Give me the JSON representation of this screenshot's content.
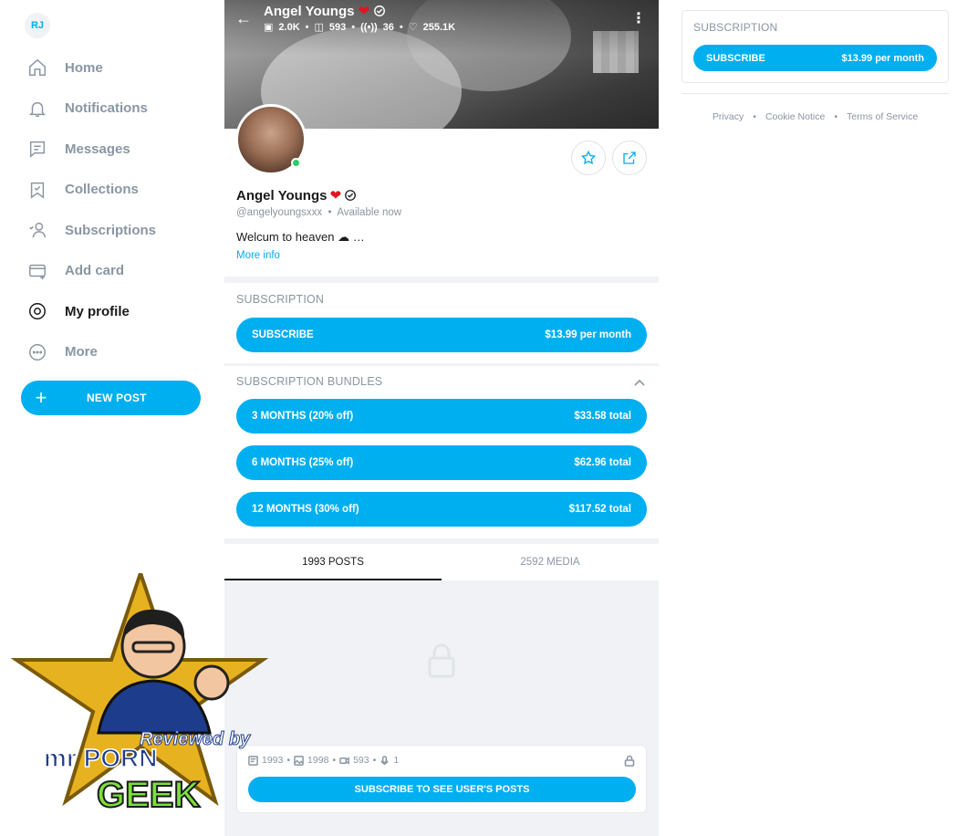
{
  "sidebar": {
    "avatar_initials": "RJ",
    "items": [
      {
        "label": "Home",
        "icon": "home-icon"
      },
      {
        "label": "Notifications",
        "icon": "bell-icon"
      },
      {
        "label": "Messages",
        "icon": "message-icon"
      },
      {
        "label": "Collections",
        "icon": "bookmark-icon"
      },
      {
        "label": "Subscriptions",
        "icon": "subscriptions-icon"
      },
      {
        "label": "Add card",
        "icon": "card-icon"
      },
      {
        "label": "My profile",
        "icon": "profile-icon"
      },
      {
        "label": "More",
        "icon": "more-icon"
      }
    ],
    "active_item": "My profile",
    "new_post_label": "NEW POST"
  },
  "cover": {
    "title": "Angel Youngs",
    "stats": {
      "photos": "2.0K",
      "videos": "593",
      "streams": "36",
      "likes": "255.1K"
    }
  },
  "profile": {
    "name": "Angel Youngs",
    "handle": "@angelyoungsxxx",
    "status": "Available now",
    "bio": "Welcum to heaven",
    "more_info": "More info"
  },
  "subscription": {
    "title": "SUBSCRIPTION",
    "button_label": "SUBSCRIBE",
    "price": "$13.99 per month"
  },
  "bundles": {
    "title": "SUBSCRIPTION BUNDLES",
    "items": [
      {
        "label": "3 MONTHS (20% off)",
        "price": "$33.58 total"
      },
      {
        "label": "6 MONTHS (25% off)",
        "price": "$62.96 total"
      },
      {
        "label": "12 MONTHS (30% off)",
        "price": "$117.52 total"
      }
    ]
  },
  "tabs": [
    {
      "label": "1993 POSTS",
      "active": true
    },
    {
      "label": "2592 MEDIA",
      "active": false
    }
  ],
  "locked": {
    "posts": "1993",
    "photos": "1998",
    "videos": "593",
    "audio": "1",
    "button_label": "SUBSCRIBE TO SEE USER'S POSTS"
  },
  "right": {
    "title": "SUBSCRIPTION",
    "button_label": "SUBSCRIBE",
    "price": "$13.99 per month",
    "footer_links": [
      "Privacy",
      "Cookie Notice",
      "Terms of Service"
    ]
  },
  "badge": {
    "line1": "Reviewed by",
    "line2": "mr PORN",
    "line3": "GEEK"
  },
  "colors": {
    "accent": "#00aff0",
    "muted": "#8a96a3",
    "online": "#29cc6a",
    "heart": "#e0161f"
  }
}
